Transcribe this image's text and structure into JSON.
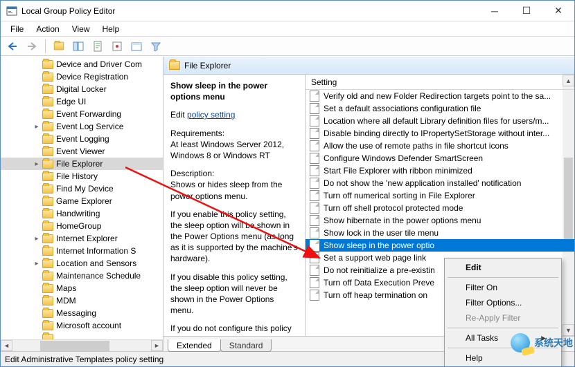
{
  "window": {
    "title": "Local Group Policy Editor",
    "status": "Edit Administrative Templates policy setting"
  },
  "menubar": [
    "File",
    "Action",
    "View",
    "Help"
  ],
  "toolbar_icons": [
    "back",
    "forward",
    "up-folder",
    "tree-toggle",
    "export-list",
    "refresh",
    "properties",
    "filter"
  ],
  "tree": {
    "items": [
      {
        "label": "Device and Driver Com",
        "expander": ""
      },
      {
        "label": "Device Registration",
        "expander": ""
      },
      {
        "label": "Digital Locker",
        "expander": ""
      },
      {
        "label": "Edge UI",
        "expander": ""
      },
      {
        "label": "Event Forwarding",
        "expander": ""
      },
      {
        "label": "Event Log Service",
        "expander": ">"
      },
      {
        "label": "Event Logging",
        "expander": ""
      },
      {
        "label": "Event Viewer",
        "expander": ""
      },
      {
        "label": "File Explorer",
        "expander": ">",
        "selected": true
      },
      {
        "label": "File History",
        "expander": ""
      },
      {
        "label": "Find My Device",
        "expander": ""
      },
      {
        "label": "Game Explorer",
        "expander": ""
      },
      {
        "label": "Handwriting",
        "expander": ""
      },
      {
        "label": "HomeGroup",
        "expander": ""
      },
      {
        "label": "Internet Explorer",
        "expander": ">"
      },
      {
        "label": "Internet Information S",
        "expander": ""
      },
      {
        "label": "Location and Sensors",
        "expander": ">"
      },
      {
        "label": "Maintenance Schedule",
        "expander": ""
      },
      {
        "label": "Maps",
        "expander": ""
      },
      {
        "label": "MDM",
        "expander": ""
      },
      {
        "label": "Messaging",
        "expander": ""
      },
      {
        "label": "Microsoft account",
        "expander": ""
      },
      {
        "label": "",
        "expander": ""
      }
    ]
  },
  "right_header": "File Explorer",
  "info": {
    "title": "Show sleep in the power options menu",
    "edit_prefix": "Edit ",
    "edit_link": "policy setting",
    "req_label": "Requirements:",
    "req_text": "At least Windows Server 2012, Windows 8 or Windows RT",
    "desc_label": "Description:",
    "desc_text": "Shows or hides sleep from the power options menu.",
    "para1": "If you enable this policy setting, the sleep option will be shown in the Power Options menu (as long as it is supported by the machine's hardware).",
    "para2": "If you disable this policy setting, the sleep option will never be shown in the Power Options menu.",
    "para3_cut": "If you do not configure this policy"
  },
  "settings": {
    "header": "Setting",
    "rows": [
      "Verify old and new Folder Redirection targets point to the sa...",
      "Set a default associations configuration file",
      "Location where all default Library definition files for users/m...",
      "Disable binding directly to IPropertySetStorage without inter...",
      "Allow the use of remote paths in file shortcut icons",
      "Configure Windows Defender SmartScreen",
      "Start File Explorer with ribbon minimized",
      "Do not show the 'new application installed' notification",
      "Turn off numerical sorting in File Explorer",
      "Turn off shell protocol protected mode",
      "Show hibernate in the power options menu",
      "Show lock in the user tile menu",
      "Show sleep in the power optio",
      "Set a support web page link",
      "Do not reinitialize a pre-existin",
      "Turn off Data Execution Preve",
      "Turn off heap termination on"
    ],
    "selected_index": 12
  },
  "context_menu": {
    "items": [
      {
        "label": "Edit",
        "default": true
      },
      {
        "sep": true
      },
      {
        "label": "Filter On"
      },
      {
        "label": "Filter Options..."
      },
      {
        "label": "Re-Apply Filter",
        "disabled": true
      },
      {
        "sep": true
      },
      {
        "label": "All Tasks",
        "submenu": true
      },
      {
        "sep": true
      },
      {
        "label": "Help"
      }
    ]
  },
  "tabs": {
    "extended": "Extended",
    "standard": "Standard"
  },
  "watermark": "系统天地"
}
